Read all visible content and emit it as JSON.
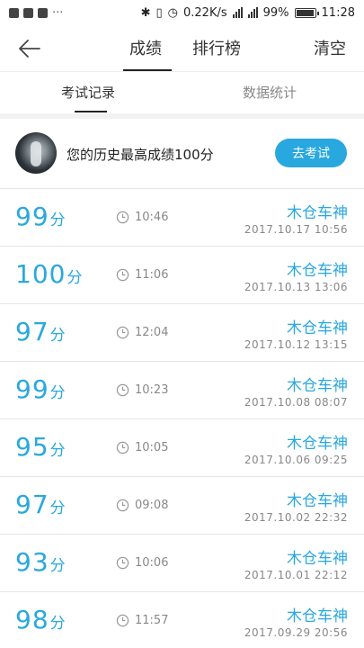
{
  "status_bar": {
    "speed": "0.22K/s",
    "battery_percent": "99%",
    "battery_level": 0.99,
    "time": "11:28"
  },
  "nav": {
    "tabs": [
      {
        "label": "成绩"
      },
      {
        "label": "排行榜"
      }
    ],
    "clear_label": "清空"
  },
  "subtabs": [
    {
      "label": "考试记录"
    },
    {
      "label": "数据统计"
    }
  ],
  "best": {
    "text": "您的历史最高成绩100分",
    "button_label": "去考试"
  },
  "records": [
    {
      "score": "99",
      "unit": "分",
      "time": "10:46",
      "name": "木仓车神",
      "datetime": "2017.10.17 10:56"
    },
    {
      "score": "100",
      "unit": "分",
      "time": "11:06",
      "name": "木仓车神",
      "datetime": "2017.10.13 13:06"
    },
    {
      "score": "97",
      "unit": "分",
      "time": "12:04",
      "name": "木仓车神",
      "datetime": "2017.10.12 13:15"
    },
    {
      "score": "99",
      "unit": "分",
      "time": "10:23",
      "name": "木仓车神",
      "datetime": "2017.10.08 08:07"
    },
    {
      "score": "95",
      "unit": "分",
      "time": "10:05",
      "name": "木仓车神",
      "datetime": "2017.10.06 09:25"
    },
    {
      "score": "97",
      "unit": "分",
      "time": "09:08",
      "name": "木仓车神",
      "datetime": "2017.10.02 22:32"
    },
    {
      "score": "93",
      "unit": "分",
      "time": "10:06",
      "name": "木仓车神",
      "datetime": "2017.10.01 22:12"
    },
    {
      "score": "98",
      "unit": "分",
      "time": "11:57",
      "name": "木仓车神",
      "datetime": "2017.09.29 20:56"
    }
  ]
}
